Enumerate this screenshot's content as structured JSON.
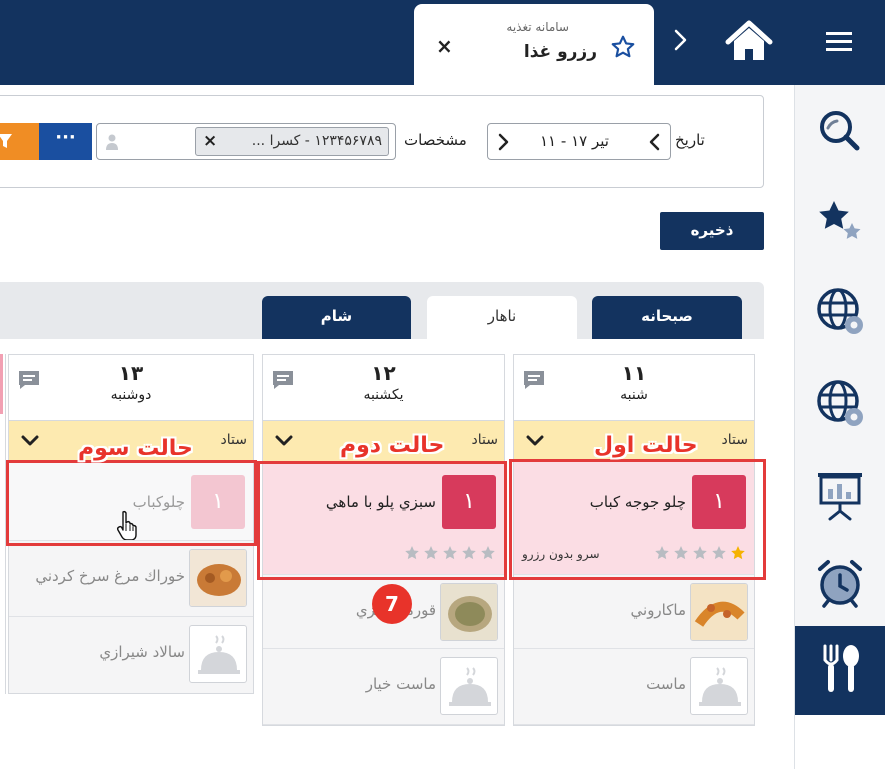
{
  "header": {
    "app_name": "سامانه تغذیه",
    "page_title": "رزرو غذا"
  },
  "filter": {
    "date_label": "تاریخ",
    "date_value": "تیر ۱۷ - ۱۱",
    "person_label": "مشخصات",
    "person_value": "۱۲۳۴۵۶۷۸۹ - کسرا ...",
    "more_label": "···"
  },
  "actions": {
    "save_label": "ذخیره"
  },
  "meal_tabs": [
    {
      "label": "صبحانه",
      "active": false
    },
    {
      "label": "ناهار",
      "active": true
    },
    {
      "label": "شام",
      "active": false
    }
  ],
  "days": [
    {
      "number": "۱۱",
      "name": "شنبه",
      "staff": "ستاد",
      "annotation": "حالت اول",
      "reserved": {
        "name": "چلو جوجه کباب",
        "qty": "۱",
        "rating": 1,
        "note": "سرو بدون رزرو"
      },
      "items": [
        {
          "name": "ماكاروني"
        },
        {
          "name": "ماست"
        }
      ]
    },
    {
      "number": "۱۲",
      "name": "یکشنبه",
      "staff": "ستاد",
      "annotation": "حالت دوم",
      "reserved": {
        "name": "سبزي پلو با ماهي",
        "qty": "۱",
        "rating": 0,
        "note": ""
      },
      "items": [
        {
          "name": "قورمه سبزي"
        },
        {
          "name": "ماست خيار"
        }
      ]
    },
    {
      "number": "۱۳",
      "name": "دوشنبه",
      "staff": "ستاد",
      "annotation": "حالت سوم",
      "reserved": {
        "name": "چلوكباب",
        "qty": "۱",
        "rating": 0,
        "note": ""
      },
      "items": [
        {
          "name": "خوراك مرغ سرخ كردني"
        },
        {
          "name": "سالاد شيرازي"
        }
      ]
    }
  ],
  "step_badge": "7",
  "colors": {
    "navy": "#13335f",
    "accent_blue": "#1a4fa0",
    "orange": "#f08d24",
    "staff_yellow": "#fdeab0",
    "reserved_pink": "#fbdde4",
    "qty_red": "#d73a5c",
    "annotation_red": "#e8332a",
    "star_gold": "#f5b301"
  },
  "icons": {
    "sidebar": [
      "search-icon",
      "favorites-icon",
      "globe-settings-icon",
      "globe-settings-icon",
      "presentation-icon",
      "alarm-icon",
      "food-icon"
    ]
  }
}
